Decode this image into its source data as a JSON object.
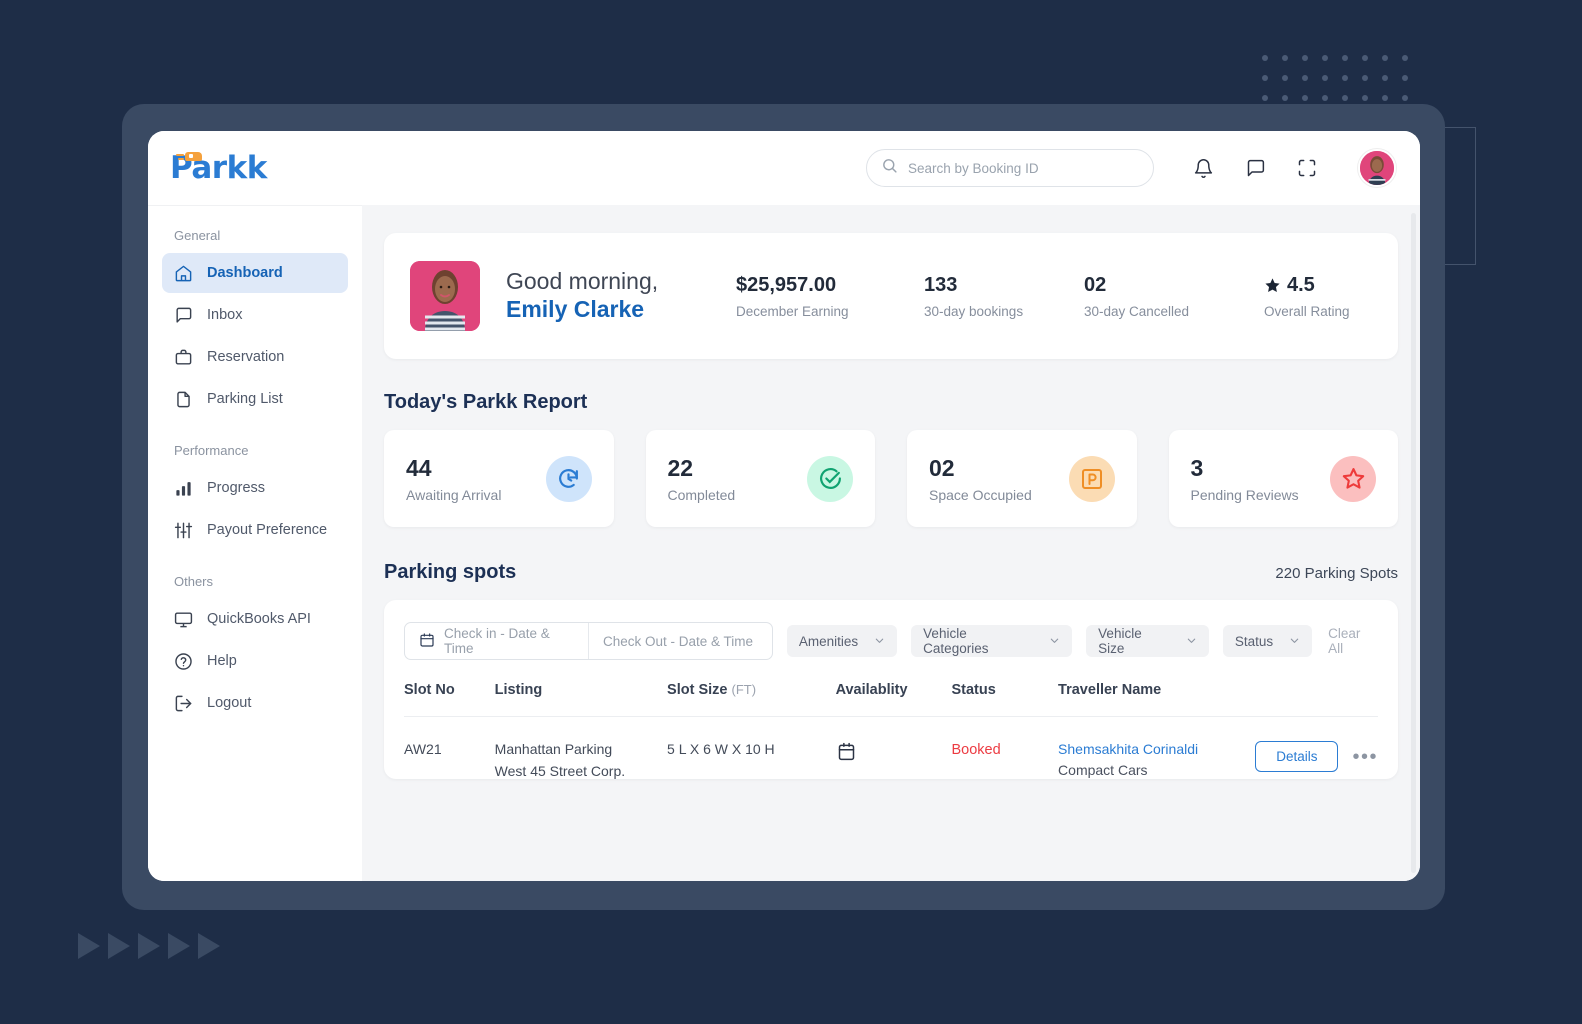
{
  "brand": {
    "name": "Parkk",
    "color": "#2b7cd3",
    "accent_orange": "#f5a13c"
  },
  "topbar": {
    "search_placeholder": "Search by Booking ID",
    "icons": [
      "bell-icon",
      "chat-icon",
      "fullscreen-icon",
      "avatar"
    ]
  },
  "sidebar": {
    "groups": [
      {
        "label": "General",
        "items": [
          {
            "label": "Dashboard",
            "icon": "home-icon",
            "active": true
          },
          {
            "label": "Inbox",
            "icon": "chat-icon",
            "active": false
          },
          {
            "label": "Reservation",
            "icon": "briefcase-icon",
            "active": false
          },
          {
            "label": "Parking List",
            "icon": "file-icon",
            "active": false
          }
        ]
      },
      {
        "label": "Performance",
        "items": [
          {
            "label": "Progress",
            "icon": "bar-chart-icon",
            "active": false
          },
          {
            "label": "Payout Preference",
            "icon": "sliders-icon",
            "active": false
          }
        ]
      },
      {
        "label": "Others",
        "items": [
          {
            "label": "QuickBooks API",
            "icon": "monitor-icon",
            "active": false
          },
          {
            "label": "Help",
            "icon": "question-circle-icon",
            "active": false
          },
          {
            "label": "Logout",
            "icon": "logout-icon",
            "active": false
          }
        ]
      }
    ]
  },
  "greeting": {
    "line1": "Good morning,",
    "name": "Emily Clarke",
    "stats": [
      {
        "value": "$25,957.00",
        "label": "December Earning"
      },
      {
        "value": "133",
        "label": "30-day bookings"
      },
      {
        "value": "02",
        "label": "30-day Cancelled"
      },
      {
        "value": "4.5",
        "label": "Overall Rating",
        "icon": "star-icon"
      }
    ]
  },
  "report": {
    "title": "Today's Parkk Report",
    "cards": [
      {
        "number": "44",
        "label": "Awaiting Arrival",
        "icon": "clock-rotate-icon",
        "bg": "#cfe4fb",
        "fg": "#2b7cd3"
      },
      {
        "number": "22",
        "label": "Completed",
        "icon": "check-circle-icon",
        "bg": "#c9f7e3",
        "fg": "#10a371"
      },
      {
        "number": "02",
        "label": "Space Occupied",
        "icon": "parking-p-icon",
        "bg": "#fbdcb4",
        "fg": "#ef8e25"
      },
      {
        "number": "3",
        "label": "Pending Reviews",
        "icon": "star-outline-icon",
        "bg": "#fbbfbf",
        "fg": "#ee3b3b"
      }
    ]
  },
  "parking": {
    "title": "Parking spots",
    "count_label": "220 Parking Spots",
    "filters": {
      "checkin_placeholder": "Check in - Date & Time",
      "checkout_placeholder": "Check Out - Date & Time",
      "chips": [
        "Amenities",
        "Vehicle Categories",
        "Vehicle Size",
        "Status"
      ],
      "clear_all": "Clear All"
    },
    "table": {
      "columns": [
        "Slot No",
        "Listing",
        "Slot Size",
        "Availablity",
        "Status",
        "Traveller Name",
        ""
      ],
      "slot_size_unit": "(FT)",
      "rows": [
        {
          "slot_no": "AW21",
          "listing_line1": "Manhattan Parking",
          "listing_line2": "West 45 Street Corp.",
          "slot_size": "5 L X 6 W X 10 H",
          "availability_icon": "calendar-icon",
          "status": "Booked",
          "traveller_name": "Shemsakhita Corinaldi",
          "traveller_sub": "Compact Cars",
          "details_label": "Details",
          "more_label": "•••"
        }
      ]
    }
  }
}
